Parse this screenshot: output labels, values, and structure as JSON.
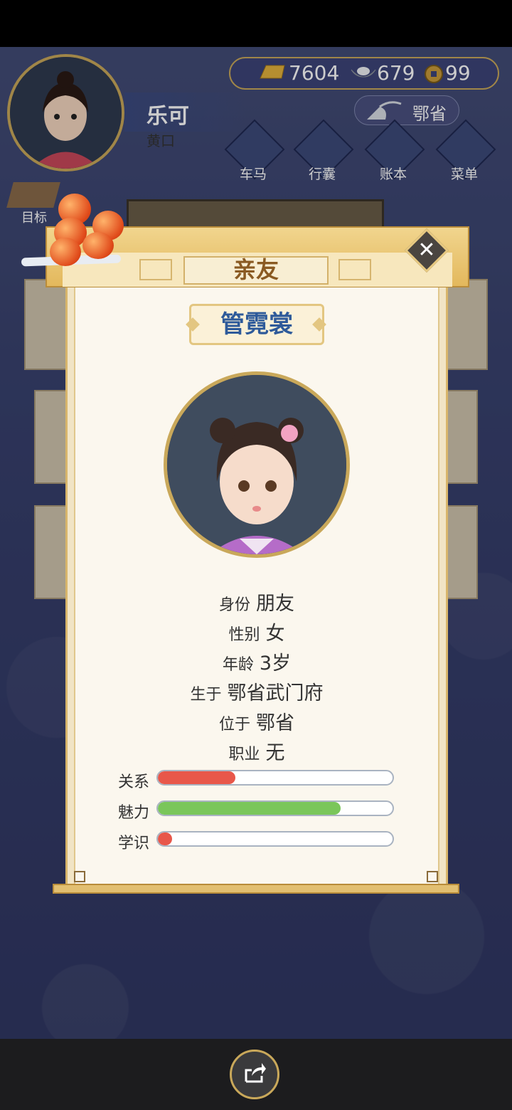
{
  "player": {
    "name": "乐可",
    "title": "黄口",
    "gold": "7604",
    "silver": "679",
    "coins": "99",
    "location": "鄂省"
  },
  "menu": [
    {
      "label": "车马",
      "icon": "carriage-icon"
    },
    {
      "label": "行囊",
      "icon": "bag-icon"
    },
    {
      "label": "账本",
      "icon": "ledger-icon"
    },
    {
      "label": "菜单",
      "icon": "more-icon"
    }
  ],
  "goal_label": "目标",
  "modal": {
    "title": "亲友",
    "person_name": "管霓裳",
    "info": [
      {
        "label": "身份",
        "value": "朋友"
      },
      {
        "label": "性别",
        "value": "女"
      },
      {
        "label": "年龄",
        "value": "3岁"
      },
      {
        "label": "生于",
        "value": "鄂省武门府"
      },
      {
        "label": "位于",
        "value": "鄂省"
      },
      {
        "label": "职业",
        "value": "无"
      }
    ],
    "stats": [
      {
        "label": "关系",
        "level": 0.33,
        "color": "#e8574a"
      },
      {
        "label": "魅力",
        "level": 0.78,
        "color": "#7ac65a"
      },
      {
        "label": "学识",
        "level": 0.06,
        "color": "#e8574a"
      }
    ]
  },
  "colors": {
    "accent_gold": "#c9a85a",
    "name_blue": "#2e5a9a",
    "panel": "#fbf7ee"
  }
}
